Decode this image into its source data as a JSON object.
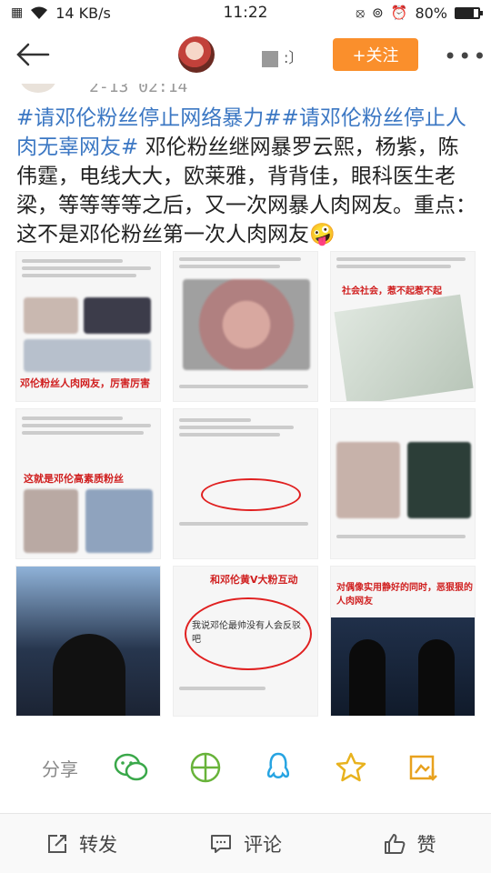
{
  "status_bar": {
    "network_speed": "14 KB/s",
    "time": "11:22",
    "battery_percent": "80%",
    "battery_level": 0.8
  },
  "nav": {
    "follow_label": "+关注",
    "more_label": "•••"
  },
  "post": {
    "time": "2-13 02:14",
    "hashtag": "#请邓伦粉丝停止网络暴力##请邓伦粉丝停止人肉无辜网友#",
    "body": " 邓伦粉丝继网暴罗云熙，杨紫，陈伟霆，电线大大，欧莱雅，背背佳，眼科医生老梁，等等等等之后，又一次网暴人肉网友。重点：这不是邓伦粉丝第一次人肉网友",
    "emoji": "🤪"
  },
  "images": {
    "c1_caption": "邓伦粉丝人肉网友，厉害厉害",
    "c3_caption": "社会社会，惹不起惹不起",
    "c4_caption": "这就是邓伦高素质粉丝",
    "c5_caption": "和邓伦黄V大粉互动",
    "c5_reply": "我说邓伦最帅没有人会反驳吧",
    "c9_caption": "对偶像实用静好的同时，恶狠狠的人肉网友"
  },
  "share": {
    "label": "分享"
  },
  "actions": {
    "repost": "转发",
    "comment": "评论",
    "like": "赞"
  },
  "colors": {
    "follow_button": "#fa8f2c",
    "hashtag": "#3b77c3",
    "annotation_red": "#e02020"
  }
}
